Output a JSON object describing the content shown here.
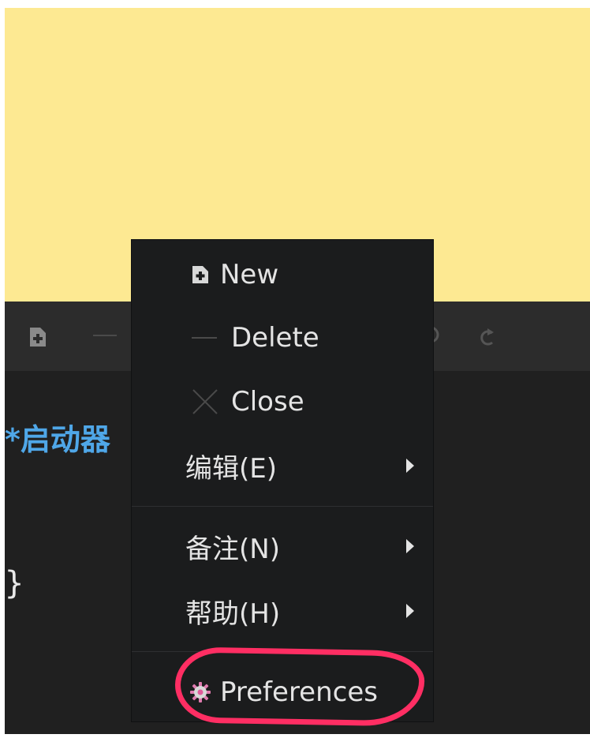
{
  "editor": {
    "title": "*启动器",
    "brace": "}"
  },
  "context_menu": {
    "items": [
      {
        "label": "New",
        "icon": "new-note-icon"
      },
      {
        "label": "Delete",
        "icon": "minus-icon"
      },
      {
        "label": "Close",
        "icon": "close-icon"
      },
      {
        "label": "编辑(E)",
        "submenu": true
      },
      {
        "label": "备注(N)",
        "submenu": true
      },
      {
        "label": "帮助(H)",
        "submenu": true
      },
      {
        "label": "Preferences",
        "icon": "gear-icon"
      }
    ]
  },
  "colors": {
    "note_background": "#fde992",
    "toolbar_background": "#2c2c2c",
    "editor_background": "#202020",
    "menu_background": "#1b1c1d",
    "title_color": "#4fa7e8",
    "annotation_color": "#ff2e63"
  }
}
